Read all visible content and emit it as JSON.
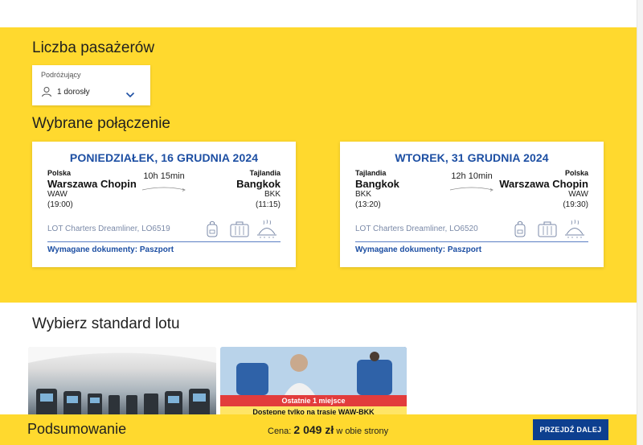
{
  "passengers": {
    "section_title": "Liczba pasażerów",
    "field_label": "Podróżujący",
    "value": "1 dorosły"
  },
  "connection": {
    "section_title": "Wybrane połączenie",
    "outbound": {
      "date": "PONIEDZIAŁEK, 16 GRUDNIA 2024",
      "from_country": "Polska",
      "from_city": "Warszawa Chopin",
      "from_code": "WAW",
      "from_time": "(19:00)",
      "duration": "10h 15min",
      "to_country": "Tajlandia",
      "to_city": "Bangkok",
      "to_code": "BKK",
      "to_time": "(11:15)",
      "aircraft": "LOT Charters Dreamliner, LO6519",
      "docs_label": "Wymagane dokumenty:",
      "docs_value": "Paszport"
    },
    "return": {
      "date": "WTOREK, 31 GRUDNIA 2024",
      "from_country": "Tajlandia",
      "from_city": "Bangkok",
      "from_code": "BKK",
      "from_time": "(13:20)",
      "duration": "12h 10min",
      "to_country": "Polska",
      "to_city": "Warszawa Chopin",
      "to_code": "WAW",
      "to_time": "(19:30)",
      "aircraft": "LOT Charters Dreamliner, LO6520",
      "docs_label": "Wymagane dokumenty:",
      "docs_value": "Paszport"
    }
  },
  "fares": {
    "section_title": "Wybierz standard lotu",
    "cards": [
      {
        "badge_last": "",
        "badge_route": ""
      },
      {
        "badge_last": "Ostatnie 1 miejsce",
        "badge_route": "Dostępne tylko na trasie WAW-BKK"
      }
    ]
  },
  "footer": {
    "title": "Podsumowanie",
    "price_label": "Cena:",
    "price_amount": "2 049 zł",
    "price_suffix": "w obie strony",
    "next_button": "PRZEJDŹ DALEJ"
  },
  "colors": {
    "yellow": "#ffd92e",
    "blue": "#1d4fa3",
    "button": "#0d3f8f",
    "badge_red": "#e23c3c"
  },
  "icons": [
    "user-icon",
    "chevron-down-icon",
    "backpack-icon",
    "suitcase-icon",
    "meal-icon"
  ]
}
